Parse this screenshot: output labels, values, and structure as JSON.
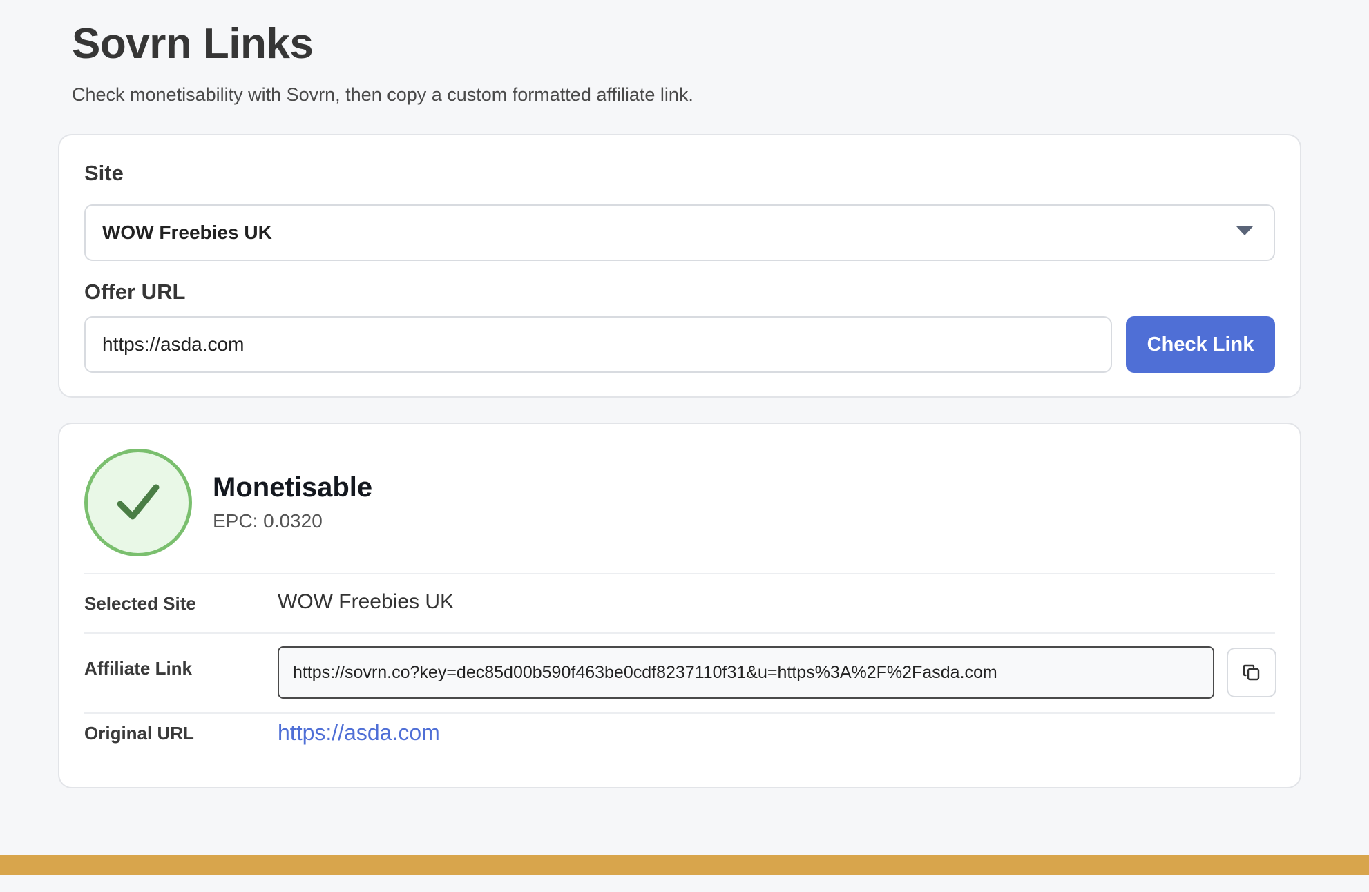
{
  "header": {
    "title": "Sovrn Links",
    "subtitle": "Check monetisability with Sovrn, then copy a custom formatted affiliate link."
  },
  "form": {
    "site_label": "Site",
    "site_selected": "WOW Freebies UK",
    "offer_url_label": "Offer URL",
    "offer_url_value": "https://asda.com",
    "check_button_label": "Check Link"
  },
  "result": {
    "status_icon": "check-icon",
    "status_title": "Monetisable",
    "epc_text": "EPC: 0.0320",
    "rows": {
      "selected_site_label": "Selected Site",
      "selected_site_value": "WOW Freebies UK",
      "affiliate_link_label": "Affiliate Link",
      "affiliate_link_value": "https://sovrn.co?key=dec85d00b590f463be0cdf8237110f31&u=https%3A%2F%2Fasda.com",
      "copy_icon": "copy-icon",
      "original_url_label": "Original URL",
      "original_url_value": "https://asda.com"
    }
  },
  "colors": {
    "accent": "#4f6fd6",
    "success_border": "#7abf6e",
    "success_fill": "#e9f8e7",
    "check_mark": "#4a7d45",
    "footer_bar": "#d8a54c"
  }
}
